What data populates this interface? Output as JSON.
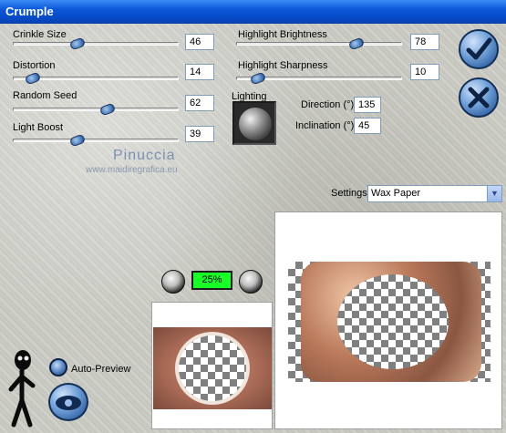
{
  "window": {
    "title": "Crumple"
  },
  "sliders": [
    {
      "label": "Crinkle Size",
      "value": "46",
      "level": 0.46
    },
    {
      "label": "Distortion",
      "value": "14",
      "level": 0.14
    },
    {
      "label": "Random Seed",
      "value": "62",
      "level": 0.62
    },
    {
      "label": "Light Boost",
      "value": "39",
      "level": 0.39
    },
    {
      "label": "Highlight Brightness",
      "value": "78",
      "level": 0.78
    },
    {
      "label": "Highlight Sharpness",
      "value": "10",
      "level": 0.1
    }
  ],
  "lighting": {
    "label": "Lighting",
    "direction_label": "Direction (°)",
    "direction_value": "135",
    "inclination_label": "Inclination (°)",
    "inclination_value": "45"
  },
  "buttons": {
    "ok_icon": "checkmark-icon",
    "cancel_icon": "cross-icon"
  },
  "watermark": {
    "name": "Pinuccia",
    "site": "www.maidiregrafica.eu"
  },
  "settings": {
    "label": "Settings:",
    "selected": "Wax Paper"
  },
  "zoom": {
    "value": "25%"
  },
  "auto_preview": {
    "label": "Auto-Preview"
  },
  "colors": {
    "zoom_background": "#17ff27",
    "title_bar": "#0a57d8"
  }
}
